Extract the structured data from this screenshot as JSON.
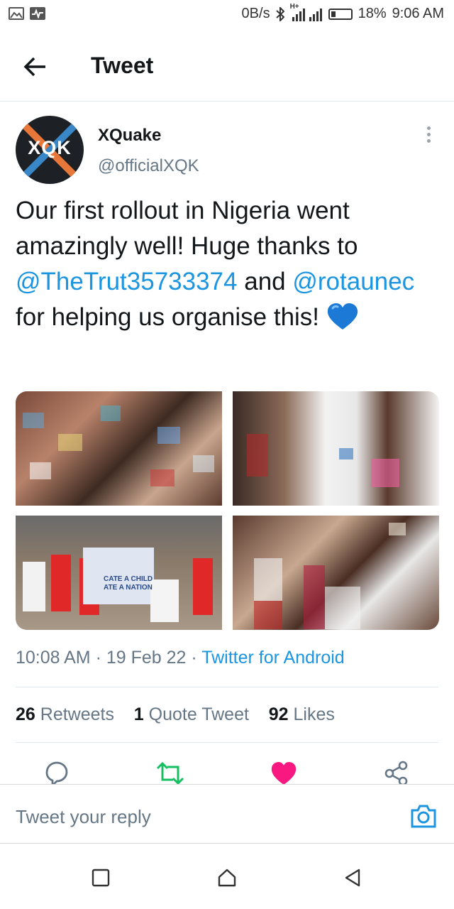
{
  "status_bar": {
    "data_rate": "0B/s",
    "network": "H+",
    "battery": "18%",
    "time": "9:06 AM"
  },
  "header": {
    "title": "Tweet"
  },
  "tweet": {
    "author_name": "XQuake",
    "author_handle": "@officialXQK",
    "avatar_logo": "XQK",
    "text_parts": {
      "p1": "Our first rollout in Nigeria went amazingly well! Huge thanks to ",
      "mention1": "@TheTrut35733374",
      "p2": " and ",
      "mention2": "@rotaunec",
      "p3": " for helping us organise this! "
    },
    "emoji": "blue-heart",
    "photo_banner_text": "CATE A CHILD\nATE A NATION",
    "time": "10:08 AM",
    "separator": " · ",
    "date": "19 Feb 22",
    "source": "Twitter for Android",
    "stats": {
      "retweets_count": "26",
      "retweets_label": "Retweets",
      "quotes_count": "1",
      "quotes_label": "Quote Tweet",
      "likes_count": "92",
      "likes_label": "Likes"
    }
  },
  "actions": [
    "reply-icon",
    "retweet-icon",
    "like-icon",
    "share-icon"
  ],
  "reply_bar": {
    "placeholder": "Tweet your reply"
  },
  "colors": {
    "link": "#1b95e0",
    "retweet": "#17bf63",
    "like": "#e0245e",
    "secondary_text": "#657786"
  }
}
